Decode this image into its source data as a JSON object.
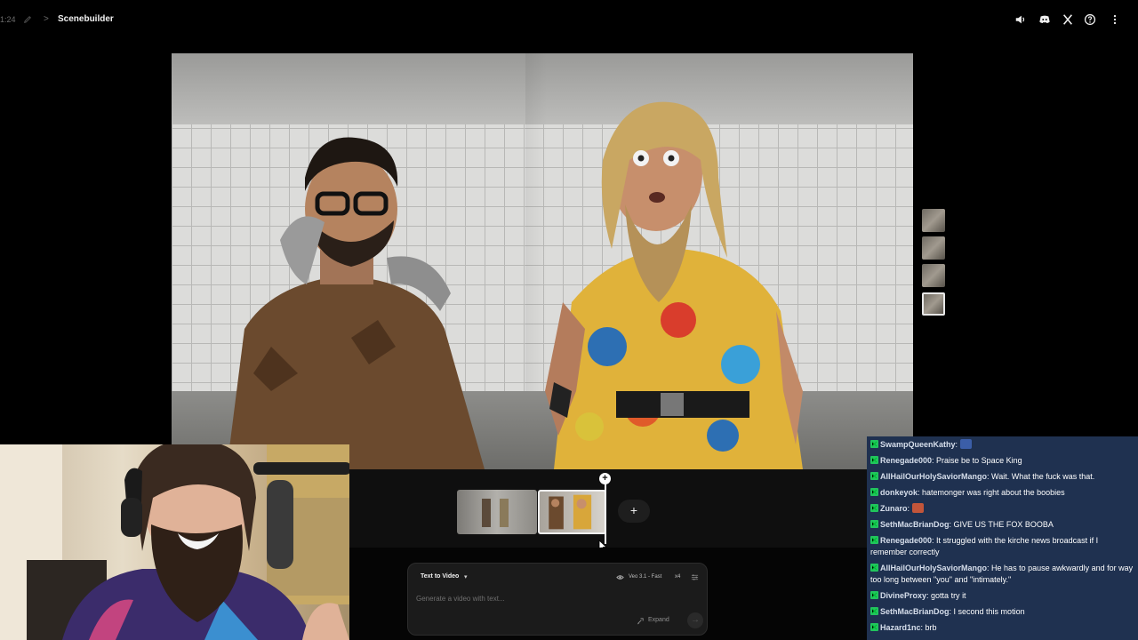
{
  "topbar": {
    "time": "1:24",
    "chevron": ">",
    "title": "Scenebuilder",
    "icons": [
      "volume-icon",
      "discord-icon",
      "x-icon",
      "help-icon",
      "more-vertical-icon"
    ]
  },
  "thumbnails": {
    "count": 4,
    "selected_index": 3
  },
  "timeline": {
    "add_label": "+",
    "playhead_label": "+"
  },
  "prompt": {
    "mode": "Text to Video",
    "mode_chevron": "▾",
    "model": "Veo 3.1 - Fast",
    "count": "x4",
    "placeholder": "Generate a video with text...",
    "expand_label": "Expand",
    "send_label": "→"
  },
  "chat": {
    "badge_color": "#22c55e",
    "messages": [
      {
        "user": "SwampQueenKathy",
        "text": "",
        "emote": "blue"
      },
      {
        "user": "Renegade000",
        "text": "Praise be to Space King"
      },
      {
        "user": "AllHailOurHolySaviorMango",
        "text": "Wait. What the fuck was that."
      },
      {
        "user": "donkeyok",
        "text": "hatemonger was right about the boobies"
      },
      {
        "user": "Zunaro",
        "text": "",
        "emote": "red"
      },
      {
        "user": "SethMacBrianDog",
        "text": "GIVE US THE FOX BOOBA"
      },
      {
        "user": "Renegade000",
        "text": "It struggled with the kirche news broadcast if I remember correctly"
      },
      {
        "user": "AllHailOurHolySaviorMango",
        "text": "He has to pause awkwardly and for way too long between \"you\" and \"intimately.\""
      },
      {
        "user": "DivineProxy",
        "text": "gotta try it"
      },
      {
        "user": "SethMacBrianDog",
        "text": "I second this motion"
      },
      {
        "user": "Hazard1nc",
        "text": "brb"
      }
    ]
  }
}
